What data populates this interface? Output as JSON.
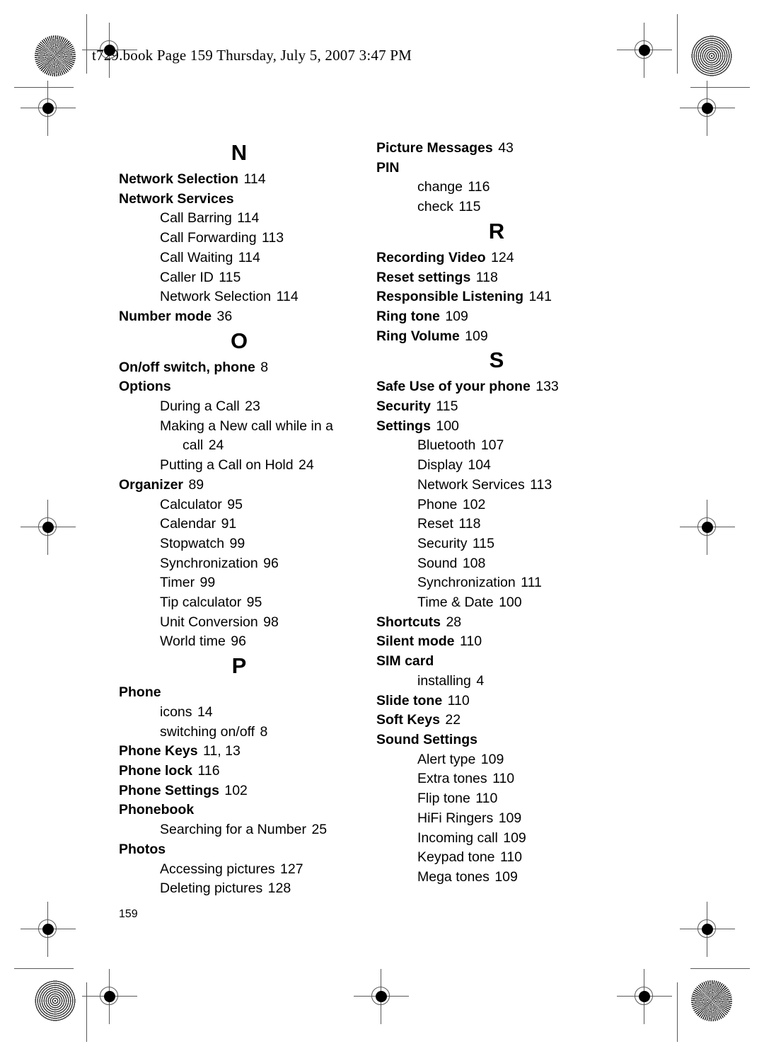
{
  "header": {
    "text": "t729.book  Page 159  Thursday, July 5, 2007  3:47 PM"
  },
  "folio": "159",
  "columns": [
    {
      "name": "left-column",
      "blocks": [
        {
          "letter": "N",
          "entries": [
            {
              "type": "main",
              "label": "Network Selection",
              "page": "114"
            },
            {
              "type": "main",
              "label": "Network Services",
              "page": ""
            },
            {
              "type": "sub",
              "label": "Call Barring",
              "page": "114"
            },
            {
              "type": "sub",
              "label": "Call Forwarding",
              "page": "113"
            },
            {
              "type": "sub",
              "label": "Call Waiting",
              "page": "114"
            },
            {
              "type": "sub",
              "label": "Caller ID",
              "page": "115"
            },
            {
              "type": "sub",
              "label": "Network Selection",
              "page": "114"
            },
            {
              "type": "main",
              "label": "Number mode",
              "page": "36"
            }
          ]
        },
        {
          "letter": "O",
          "entries": [
            {
              "type": "main",
              "label": "On/off switch, phone",
              "page": "8"
            },
            {
              "type": "main",
              "label": "Options",
              "page": ""
            },
            {
              "type": "sub",
              "label": "During a Call",
              "page": "23"
            },
            {
              "type": "sub-wrap",
              "label": "Making a New call while in a",
              "cont": "call",
              "page": "24"
            },
            {
              "type": "sub",
              "label": "Putting a Call on Hold",
              "page": "24"
            },
            {
              "type": "main",
              "label": "Organizer",
              "page": "89"
            },
            {
              "type": "sub",
              "label": "Calculator",
              "page": "95"
            },
            {
              "type": "sub",
              "label": "Calendar",
              "page": "91"
            },
            {
              "type": "sub",
              "label": "Stopwatch",
              "page": "99"
            },
            {
              "type": "sub",
              "label": "Synchronization",
              "page": "96"
            },
            {
              "type": "sub",
              "label": "Timer",
              "page": "99"
            },
            {
              "type": "sub",
              "label": "Tip calculator",
              "page": "95"
            },
            {
              "type": "sub",
              "label": "Unit Conversion",
              "page": "98"
            },
            {
              "type": "sub",
              "label": "World time",
              "page": "96"
            }
          ]
        },
        {
          "letter": "P",
          "entries": [
            {
              "type": "main",
              "label": "Phone",
              "page": ""
            },
            {
              "type": "sub",
              "label": "icons",
              "page": "14"
            },
            {
              "type": "sub",
              "label": "switching on/off",
              "page": "8"
            },
            {
              "type": "main",
              "label": "Phone Keys",
              "page": "11, 13"
            },
            {
              "type": "main",
              "label": "Phone lock",
              "page": "116"
            },
            {
              "type": "main",
              "label": "Phone Settings",
              "page": "102"
            },
            {
              "type": "main",
              "label": "Phonebook",
              "page": ""
            },
            {
              "type": "sub",
              "label": "Searching for a Number",
              "page": "25"
            },
            {
              "type": "main",
              "label": "Photos",
              "page": ""
            },
            {
              "type": "sub",
              "label": "Accessing pictures",
              "page": "127"
            },
            {
              "type": "sub",
              "label": "Deleting pictures",
              "page": "128"
            }
          ]
        }
      ]
    },
    {
      "name": "right-column",
      "blocks": [
        {
          "letter": "",
          "entries": [
            {
              "type": "main",
              "label": "Picture Messages",
              "page": "43"
            },
            {
              "type": "main",
              "label": "PIN",
              "page": ""
            },
            {
              "type": "sub",
              "label": "change",
              "page": "116"
            },
            {
              "type": "sub",
              "label": "check",
              "page": "115"
            }
          ]
        },
        {
          "letter": "R",
          "entries": [
            {
              "type": "main",
              "label": "Recording Video",
              "page": "124"
            },
            {
              "type": "main",
              "label": "Reset settings",
              "page": "118"
            },
            {
              "type": "main",
              "label": "Responsible Listening",
              "page": "141"
            },
            {
              "type": "main",
              "label": "Ring tone",
              "page": "109"
            },
            {
              "type": "main",
              "label": "Ring Volume",
              "page": "109"
            }
          ]
        },
        {
          "letter": "S",
          "entries": [
            {
              "type": "main",
              "label": "Safe Use of your phone",
              "page": "133"
            },
            {
              "type": "main",
              "label": "Security",
              "page": "115"
            },
            {
              "type": "main",
              "label": "Settings",
              "page": "100"
            },
            {
              "type": "sub",
              "label": "Bluetooth",
              "page": "107"
            },
            {
              "type": "sub",
              "label": "Display",
              "page": "104"
            },
            {
              "type": "sub",
              "label": "Network Services",
              "page": "113"
            },
            {
              "type": "sub",
              "label": "Phone",
              "page": "102"
            },
            {
              "type": "sub",
              "label": "Reset",
              "page": "118"
            },
            {
              "type": "sub",
              "label": "Security",
              "page": "115"
            },
            {
              "type": "sub",
              "label": "Sound",
              "page": "108"
            },
            {
              "type": "sub",
              "label": "Synchronization",
              "page": "111"
            },
            {
              "type": "sub",
              "label": "Time & Date",
              "page": "100"
            },
            {
              "type": "main",
              "label": "Shortcuts",
              "page": "28"
            },
            {
              "type": "main",
              "label": "Silent mode",
              "page": "110"
            },
            {
              "type": "main",
              "label": "SIM card",
              "page": ""
            },
            {
              "type": "sub",
              "label": "installing",
              "page": "4"
            },
            {
              "type": "main",
              "label": "Slide tone",
              "page": "110"
            },
            {
              "type": "main",
              "label": "Soft Keys",
              "page": "22"
            },
            {
              "type": "main",
              "label": "Sound Settings",
              "page": ""
            },
            {
              "type": "sub",
              "label": "Alert type",
              "page": "109"
            },
            {
              "type": "sub",
              "label": "Extra tones",
              "page": "110"
            },
            {
              "type": "sub",
              "label": "Flip tone",
              "page": "110"
            },
            {
              "type": "sub",
              "label": "HiFi Ringers",
              "page": "109"
            },
            {
              "type": "sub",
              "label": "Incoming call",
              "page": "109"
            },
            {
              "type": "sub",
              "label": "Keypad tone",
              "page": "110"
            },
            {
              "type": "sub",
              "label": "Mega tones",
              "page": "109"
            }
          ]
        }
      ]
    }
  ],
  "print_marks": {
    "star_target": "sunburst-registration-target",
    "ring_target": "concentric-registration-target",
    "crosshair": "crosshair-registration-mark"
  }
}
